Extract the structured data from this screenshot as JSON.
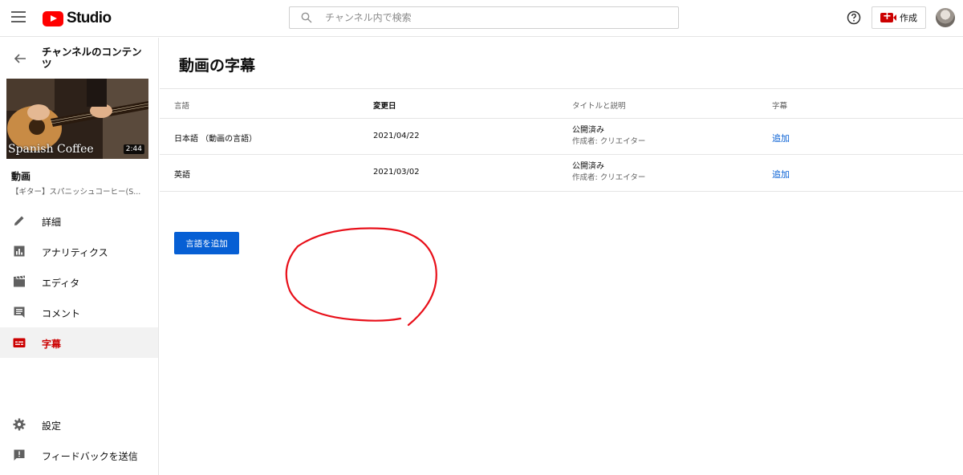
{
  "header": {
    "logo_text": "Studio",
    "search_placeholder": "チャンネル内で検索",
    "create_label": "作成"
  },
  "sidebar": {
    "channel_title": "チャンネルのコンテンツ",
    "thumbnail_title": "Spanish Coffee",
    "duration": "2:44",
    "video_section_title": "動画",
    "video_subtitle": "【ギター】スパニッシュコーヒー(S...",
    "items": [
      {
        "label": "詳細",
        "icon": "pencil-icon"
      },
      {
        "label": "アナリティクス",
        "icon": "analytics-icon"
      },
      {
        "label": "エディタ",
        "icon": "film-icon"
      },
      {
        "label": "コメント",
        "icon": "comment-icon"
      },
      {
        "label": "字幕",
        "icon": "subtitles-icon",
        "active": true
      }
    ],
    "bottom_items": [
      {
        "label": "設定",
        "icon": "gear-icon"
      },
      {
        "label": "フィードバックを送信",
        "icon": "feedback-icon"
      }
    ]
  },
  "main": {
    "title": "動画の字幕",
    "columns": [
      "言語",
      "変更日",
      "タイトルと説明",
      "字幕"
    ],
    "rows": [
      {
        "language": "日本語 （動画の言語）",
        "date": "2021/04/22",
        "status": "公開済み",
        "author": "作成者: クリエイター",
        "action": "追加"
      },
      {
        "language": "英語",
        "date": "2021/03/02",
        "status": "公開済み",
        "author": "作成者: クリエイター",
        "action": "追加"
      }
    ],
    "add_language_label": "言語を追加"
  },
  "colors": {
    "accent_blue": "#065fd4",
    "active_red": "#cc0000",
    "annotation_red": "#e8101a"
  }
}
